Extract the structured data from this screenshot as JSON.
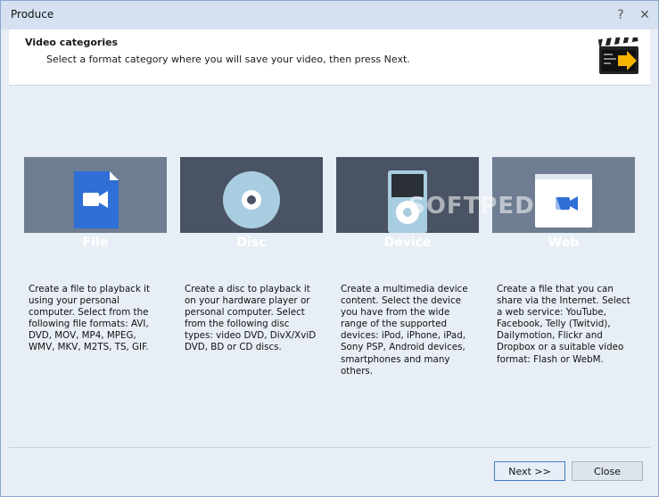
{
  "window": {
    "title": "Produce",
    "controls": {
      "help_glyph": "?",
      "close_glyph": "✕"
    }
  },
  "header": {
    "title": "Video categories",
    "subtitle": "Select a format category where you will save your video, then press Next.",
    "icon": "clapperboard-arrow-icon"
  },
  "categories": [
    {
      "label": "File",
      "icon": "file-video-icon",
      "tile_color": "#6e7d92",
      "description": "Create a file to playback it using your personal computer. Select from the following file formats: AVI, DVD, MOV, MP4, MPEG, WMV, MKV, M2TS, TS, GIF."
    },
    {
      "label": "Disc",
      "icon": "disc-icon",
      "tile_color": "#4a5363",
      "description": "Create a disc to playback it on your hardware player or personal computer. Select from the following disc types: video DVD, DivX/XviD DVD, BD or CD discs."
    },
    {
      "label": "Device",
      "icon": "media-player-icon",
      "tile_color": "#4a5363",
      "description": "Create a multimedia device content. Select the device you have from the wide range of the supported devices: iPod, iPhone, iPad, Sony PSP, Android devices, smartphones and many others."
    },
    {
      "label": "Web",
      "icon": "browser-video-icon",
      "tile_color": "#6e7d92",
      "description": "Create a file that you can share via the Internet. Select a web service: YouTube, Facebook, Telly (Twitvid), Dailymotion, Flickr and Dropbox or a suitable video format: Flash or WebM."
    }
  ],
  "watermark": "SOFTPEDIA",
  "footer": {
    "next_label": "Next >>",
    "close_label": "Close"
  },
  "colors": {
    "accent": "#2f6fd6",
    "icon_light_blue": "#a9cde0"
  }
}
